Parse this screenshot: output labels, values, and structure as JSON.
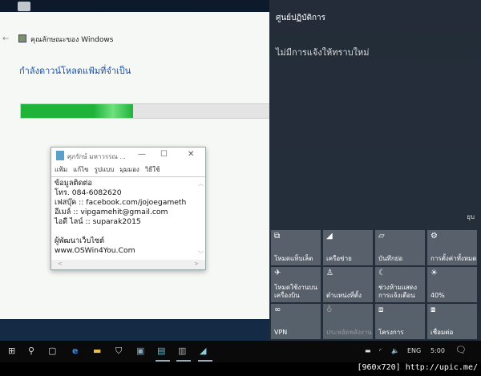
{
  "installer": {
    "title": "คุณลักษณะของ Windows",
    "heading": "กำลังดาวน์โหลดแฟ้มที่จำเป็น",
    "progress_percent": 45,
    "accent": "#1fb33a"
  },
  "notepad": {
    "title": "ศุภรักษ์ มหาวรรณ ...",
    "menu": [
      "แฟ้ม",
      "แก้ไข",
      "รูปแบบ",
      "มุมมอง",
      "วิธีใช้"
    ],
    "content": "ข้อมูลติดต่อ\nโทร. 084-6082620\nเฟสบุ๊ค :: facebook.com/jojoegameth\nอีเมล์ :: vipgamehit@gmail.com\nไอดี ไลน์ :: suparak2015\n\nผู้พัฒนาเว็บไซต์\nwww.OSWin4You.Com"
  },
  "action_center": {
    "title": "ศูนย์ปฏิบัติการ",
    "no_notifications": "ไม่มีการแจ้งให้ทราบใหม่",
    "collapse": "ยุบ",
    "tiles": [
      {
        "icon": "tablet-mode-icon",
        "label": "โหมดแท็บเล็ต"
      },
      {
        "icon": "network-icon",
        "label": "เครือข่าย"
      },
      {
        "icon": "note-icon",
        "label": "บันทึกย่อ"
      },
      {
        "icon": "settings-icon",
        "label": "การตั้งค่าทั้งหมด"
      },
      {
        "icon": "airplane-icon",
        "label": "โหมดใช้งานบนเครื่องบิน"
      },
      {
        "icon": "location-icon",
        "label": "ตำแหน่งที่ตั้ง"
      },
      {
        "icon": "quiet-hours-icon",
        "label": "ช่วงห้ามแสดงการแจ้งเตือน"
      },
      {
        "icon": "brightness-icon",
        "label": "40%"
      },
      {
        "icon": "vpn-icon",
        "label": "VPN"
      },
      {
        "icon": "battery-saver-icon",
        "label": "ประหยัดพลังงาน",
        "disabled": true
      },
      {
        "icon": "project-icon",
        "label": "โครงการ"
      },
      {
        "icon": "connect-icon",
        "label": "เชื่อมต่อ"
      }
    ]
  },
  "taskbar": {
    "language": "ENG",
    "time": "5:00"
  },
  "watermark": "[960x720] http://upic.me/"
}
